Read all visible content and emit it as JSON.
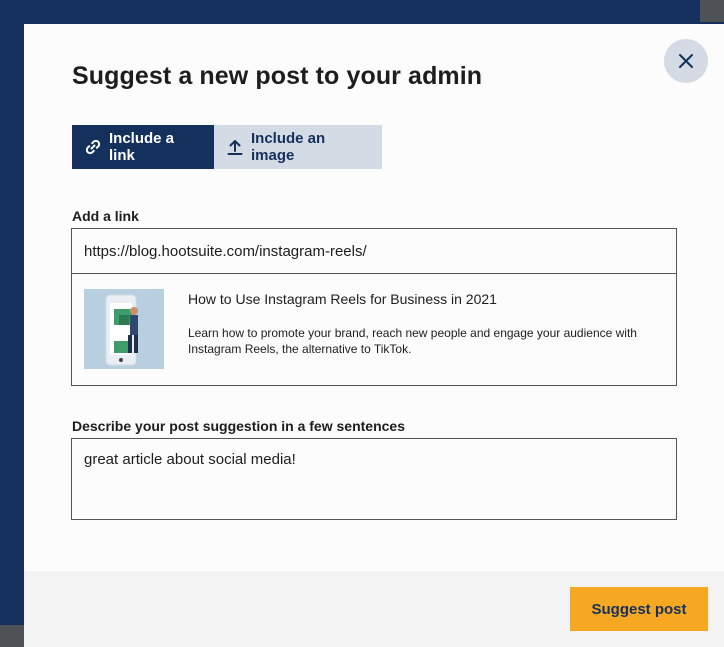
{
  "modal": {
    "title": "Suggest a new post to your admin",
    "close_icon": "close-icon"
  },
  "tabs": [
    {
      "label": "Include a link",
      "icon": "link-icon",
      "active": true
    },
    {
      "label": "Include an image",
      "icon": "upload-icon",
      "active": false
    }
  ],
  "link": {
    "label": "Add a link",
    "value": "https://blog.hootsuite.com/instagram-reels/",
    "preview": {
      "title": "How to Use Instagram Reels for Business in 2021",
      "description": "Learn how to promote your brand, reach new people and engage your audience with Instagram Reels, the alternative to TikTok.",
      "thumbnail_icon": "phone-illustration-icon"
    }
  },
  "description": {
    "label": "Describe your post suggestion in a few sentences",
    "value": "great article about social media!"
  },
  "footer": {
    "submit_label": "Suggest post"
  },
  "colors": {
    "navy": "#14305c",
    "accent": "#f7a823",
    "tab_inactive": "#d4dbe4"
  }
}
